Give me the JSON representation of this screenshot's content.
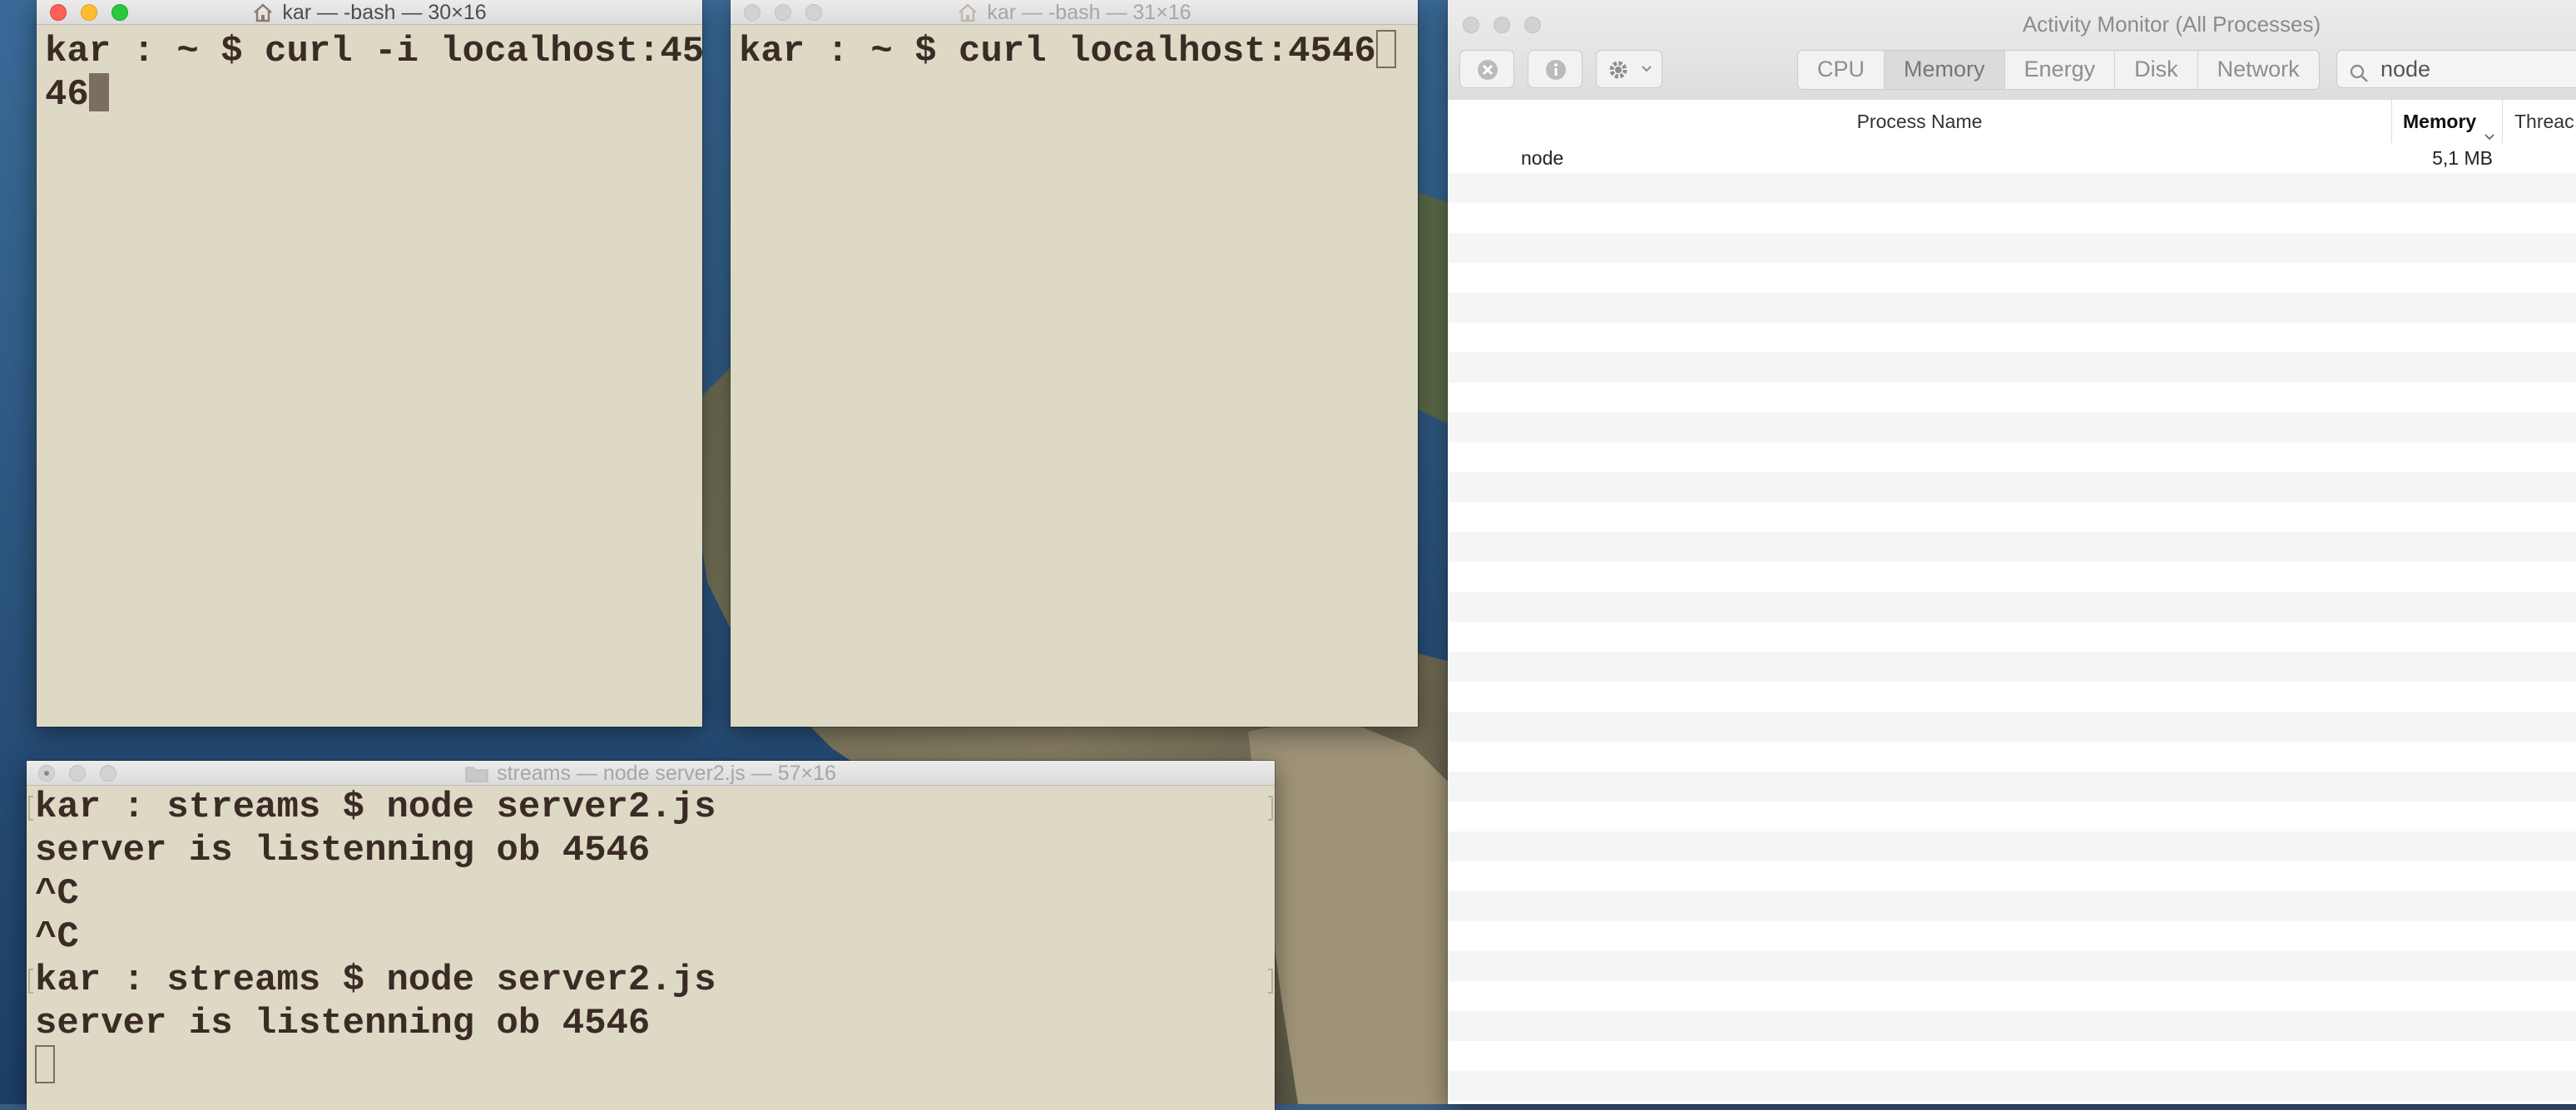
{
  "terminal1": {
    "title": "kar — -bash — 30×16",
    "lines": [
      "kar : ~ $ curl -i localhost:45",
      "46"
    ]
  },
  "terminal2": {
    "title": "kar — -bash — 31×16",
    "lines": [
      "kar : ~ $ curl localhost:4546"
    ]
  },
  "terminal3": {
    "title": "streams — node server2.js — 57×16",
    "lines": [
      "kar : streams $ node server2.js",
      "server is listenning ob 4546",
      "^C",
      "^C",
      "kar : streams $ node server2.js",
      "server is listenning ob 4546"
    ]
  },
  "activity_monitor": {
    "title": "Activity Monitor (All Processes)",
    "tabs": [
      "CPU",
      "Memory",
      "Energy",
      "Disk",
      "Network"
    ],
    "selected_tab": "Memory",
    "search_value": "node",
    "columns": {
      "process_name": "Process Name",
      "memory": "Memory",
      "threads": "Threac"
    },
    "rows": [
      {
        "name": "node",
        "memory": "5,1 MB"
      }
    ]
  },
  "colors": {
    "terminal_bg": "#ddd9c5",
    "terminal_text": "#3b2b25",
    "close": "#fe5f57",
    "minimize": "#febc2e",
    "zoom": "#28c840"
  },
  "icons": {
    "house": "house-icon",
    "folder": "folder-icon",
    "stop": "stop-process-icon",
    "info": "info-icon",
    "gear": "gear-icon",
    "search": "search-icon"
  }
}
